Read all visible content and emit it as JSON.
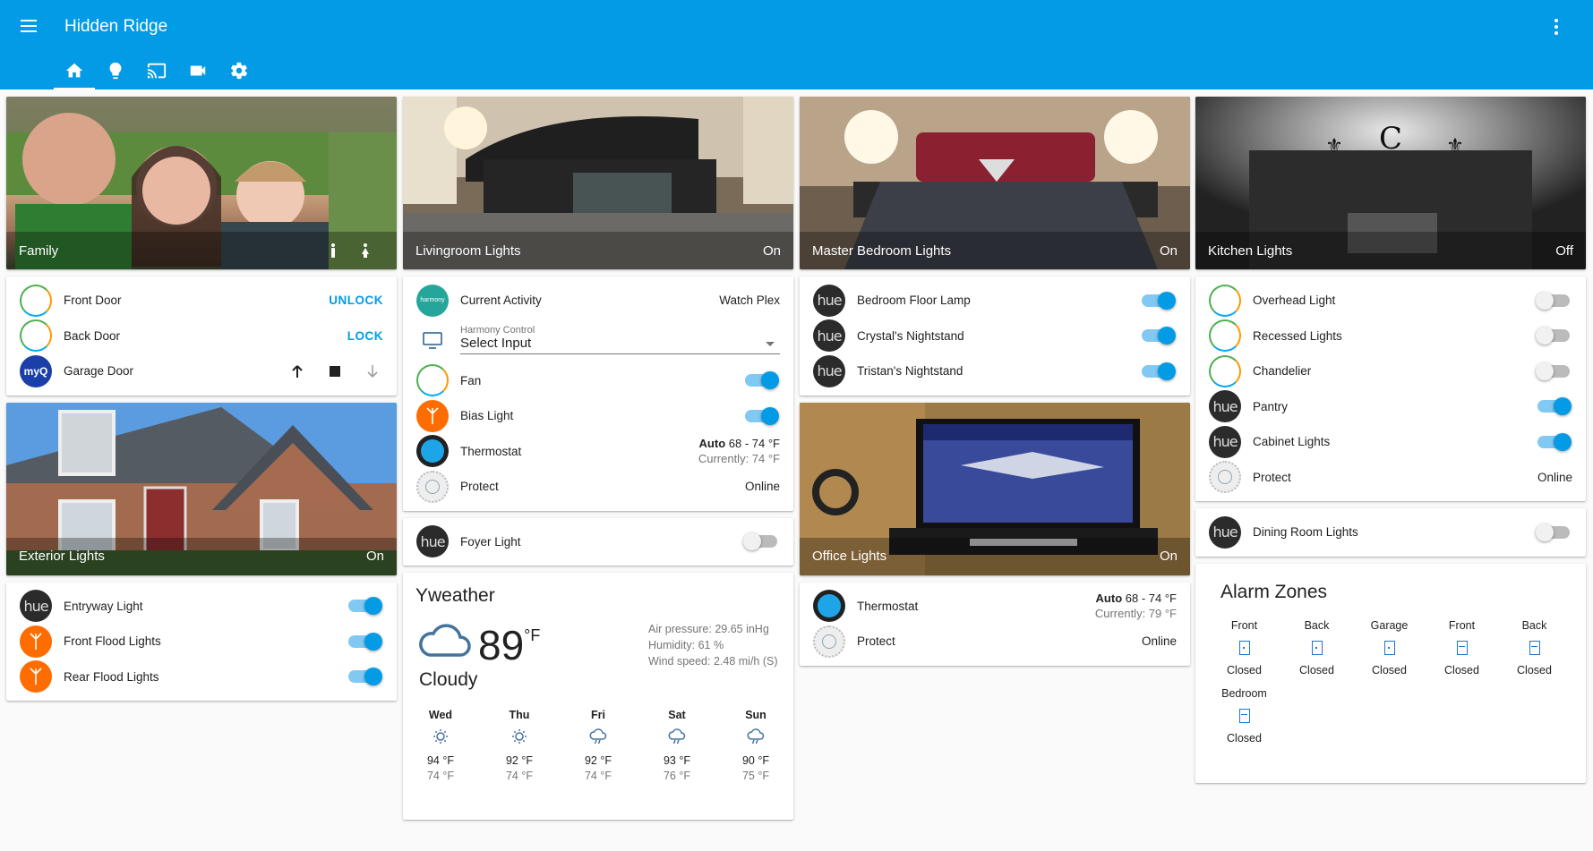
{
  "app": {
    "title": "Hidden Ridge"
  },
  "tabs": [
    {
      "name": "home",
      "icon": "home-icon"
    },
    {
      "name": "lights",
      "icon": "lightbulb-icon"
    },
    {
      "name": "cast",
      "icon": "cast-icon"
    },
    {
      "name": "camera",
      "icon": "videocam-icon"
    },
    {
      "name": "settings",
      "icon": "gear-icon"
    }
  ],
  "pictures": {
    "family": {
      "title": "Family",
      "state": ""
    },
    "livingroom": {
      "title": "Livingroom Lights",
      "state": "On"
    },
    "master": {
      "title": "Master Bedroom Lights",
      "state": "On"
    },
    "kitchen": {
      "title": "Kitchen Lights",
      "state": "Off"
    },
    "exterior": {
      "title": "Exterior Lights",
      "state": "On"
    },
    "office": {
      "title": "Office Lights",
      "state": "On"
    }
  },
  "doors": {
    "front": {
      "name": "Front Door",
      "action": "UNLOCK"
    },
    "back": {
      "name": "Back Door",
      "action": "LOCK"
    },
    "garage": {
      "name": "Garage Door",
      "logo": "myQ"
    }
  },
  "exterior_lights": [
    {
      "name": "Entryway Light",
      "on": true
    },
    {
      "name": "Front Flood Lights",
      "on": true
    },
    {
      "name": "Rear Flood Lights",
      "on": true
    }
  ],
  "living": {
    "activity_label": "Current Activity",
    "activity_value": "Watch Plex",
    "harmony_badge": "harmony",
    "harmony_label": "Harmony Control",
    "harmony_value": "Select Input",
    "fan": "Fan",
    "bias": "Bias Light",
    "thermostat": "Thermostat",
    "therm_mode": "Auto",
    "therm_range": "68 - 74 °F",
    "therm_current": "Currently: 74 °F",
    "protect": "Protect",
    "protect_state": "Online"
  },
  "foyer": {
    "name": "Foyer Light",
    "on": false
  },
  "hue_logo": "hue",
  "weather": {
    "title": "Yweather",
    "temp": "89",
    "unit": "°F",
    "condition": "Cloudy",
    "pressure": "Air pressure: 29.65 inHg",
    "humidity": "Humidity: 61 %",
    "wind": "Wind speed: 2.48 mi/h (S)",
    "forecast": [
      {
        "day": "Wed",
        "icon": "sunny-icon",
        "hi": "94 °F",
        "lo": "74 °F"
      },
      {
        "day": "Thu",
        "icon": "sunny-icon",
        "hi": "92 °F",
        "lo": "74 °F"
      },
      {
        "day": "Fri",
        "icon": "rain-cloud-icon",
        "hi": "92 °F",
        "lo": "74 °F"
      },
      {
        "day": "Sat",
        "icon": "rain-cloud-icon",
        "hi": "93 °F",
        "lo": "76 °F"
      },
      {
        "day": "Sun",
        "icon": "rain-cloud-icon",
        "hi": "90 °F",
        "lo": "75 °F"
      }
    ]
  },
  "bedroom_lights": [
    {
      "name": "Bedroom Floor Lamp",
      "on": true
    },
    {
      "name": "Crystal's Nightstand",
      "on": true
    },
    {
      "name": "Tristan's Nightstand",
      "on": true
    }
  ],
  "office": {
    "thermostat": "Thermostat",
    "therm_mode": "Auto",
    "therm_range": "68 - 74 °F",
    "therm_current": "Currently: 79 °F",
    "protect": "Protect",
    "protect_state": "Online"
  },
  "kitchen_lights": [
    {
      "name": "Overhead Light",
      "on": false
    },
    {
      "name": "Recessed Lights",
      "on": false
    },
    {
      "name": "Chandelier",
      "on": false
    },
    {
      "name": "Pantry",
      "on": true
    },
    {
      "name": "Cabinet Lights",
      "on": true
    }
  ],
  "kitchen_protect": {
    "name": "Protect",
    "state": "Online"
  },
  "dining": {
    "name": "Dining Room Lights",
    "on": false
  },
  "alarm": {
    "title": "Alarm Zones",
    "zones": [
      {
        "name": "Front",
        "state": "Closed",
        "type": "door"
      },
      {
        "name": "Back",
        "state": "Closed",
        "type": "door"
      },
      {
        "name": "Garage",
        "state": "Closed",
        "type": "door"
      },
      {
        "name": "Front",
        "state": "Closed",
        "type": "window"
      },
      {
        "name": "Back",
        "state": "Closed",
        "type": "window"
      },
      {
        "name": "Bedroom",
        "state": "Closed",
        "type": "window"
      }
    ]
  },
  "colors": {
    "primary": "#039be5",
    "accent": "#039be5",
    "flood": "#ff6d00"
  }
}
